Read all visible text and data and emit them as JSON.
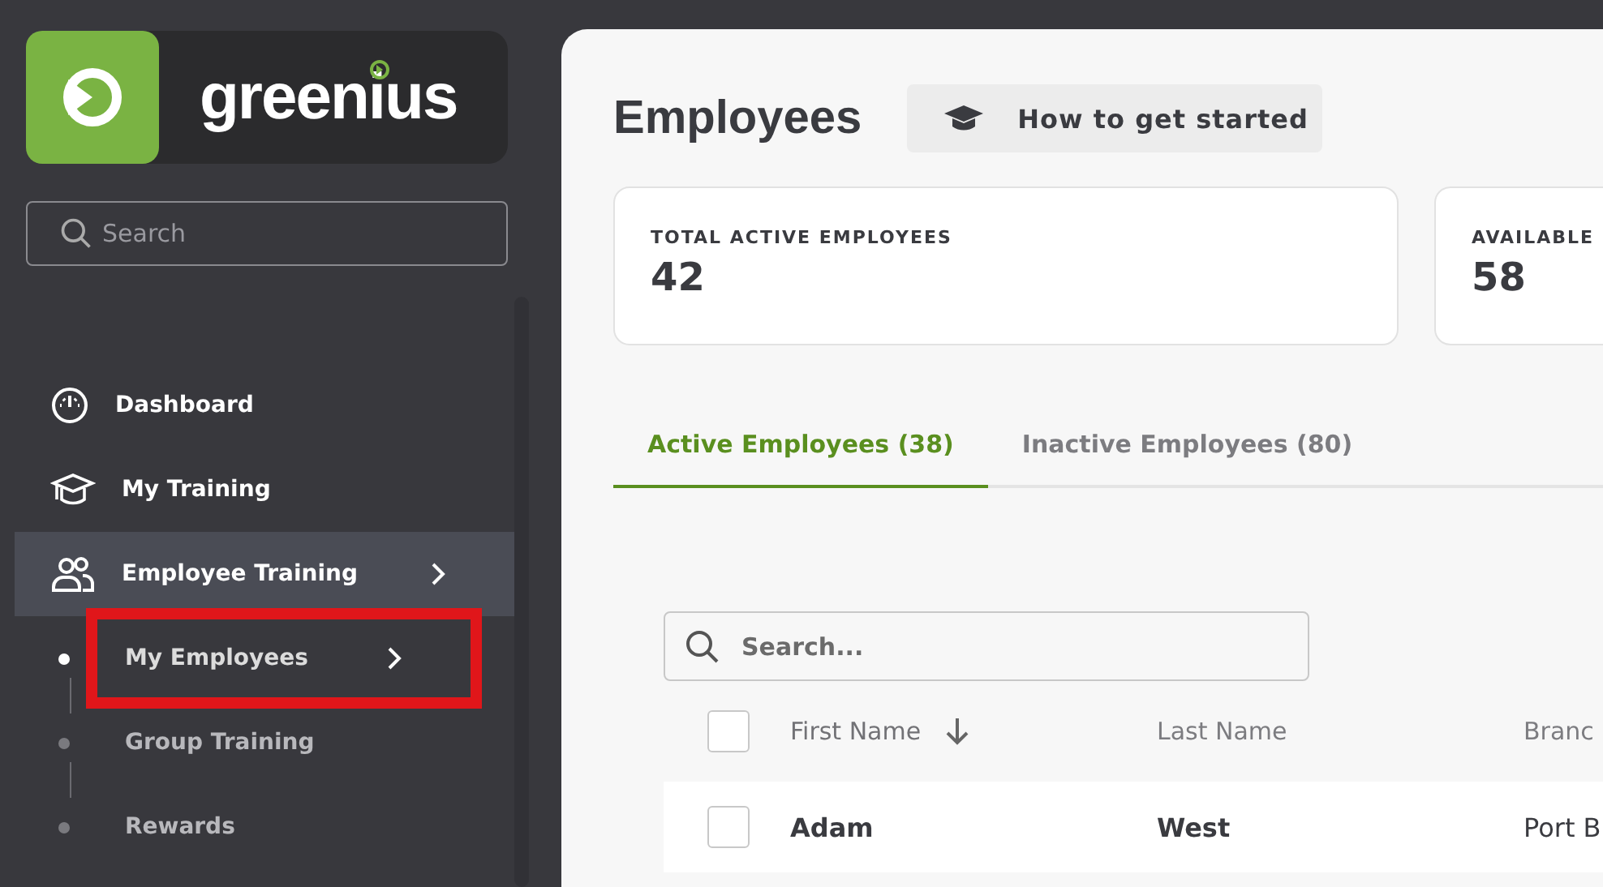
{
  "sidebar": {
    "logo": {
      "text": "greenius"
    },
    "search": {
      "placeholder": "Search"
    },
    "items": [
      {
        "label": "Dashboard",
        "selected": false
      },
      {
        "label": "My Training",
        "selected": false
      },
      {
        "label": "Employee Training",
        "selected": true,
        "expanded": true,
        "children": [
          {
            "label": "My Employees",
            "selected": true,
            "highlighted": true
          },
          {
            "label": "Group Training",
            "selected": false,
            "highlighted": false
          },
          {
            "label": "Rewards",
            "selected": false,
            "highlighted": false
          }
        ]
      }
    ]
  },
  "header": {
    "title": "Employees",
    "help_button": "How to get started"
  },
  "stats": [
    {
      "label": "TOTAL ACTIVE EMPLOYEES",
      "value": "42"
    },
    {
      "label": "AVAILABLE",
      "value": "58"
    }
  ],
  "tabs": [
    {
      "label": "Active Employees (38)",
      "selected": true
    },
    {
      "label": "Inactive Employees (80)",
      "selected": false
    }
  ],
  "table": {
    "search": {
      "placeholder": "Search..."
    },
    "select_all_checked": false,
    "columns": [
      {
        "label": "First Name",
        "sorted": true
      },
      {
        "label": "Last Name",
        "sorted": false
      },
      {
        "label": "Branc"
      }
    ],
    "rows": [
      {
        "checked": false,
        "cells": [
          "Adam",
          "West",
          "Port B"
        ]
      }
    ]
  }
}
